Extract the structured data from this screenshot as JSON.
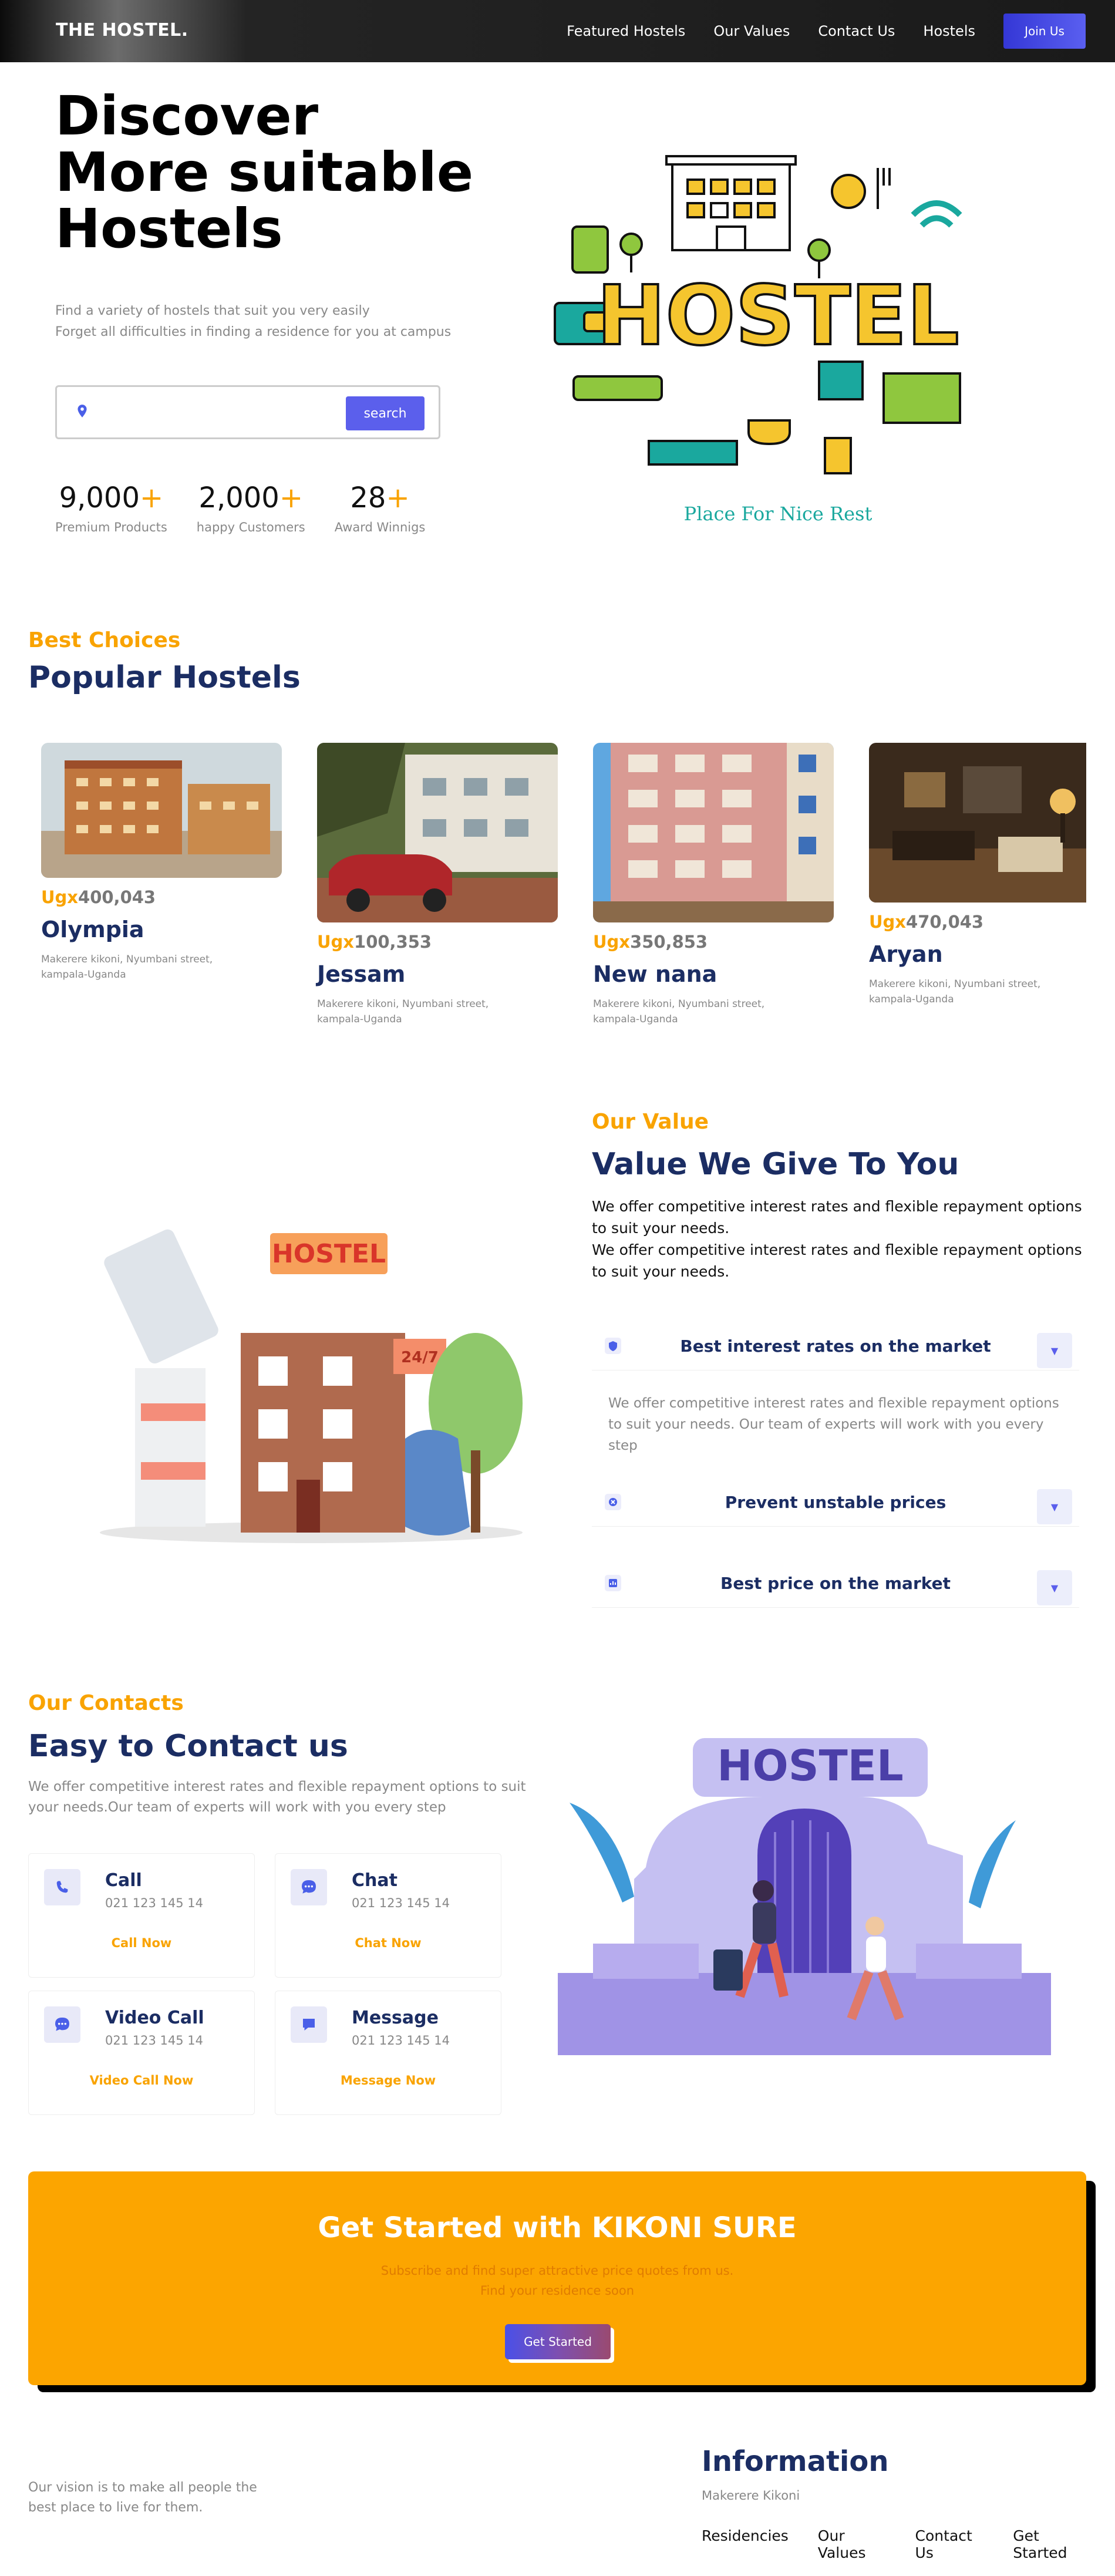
{
  "nav": {
    "logo": "THE HOSTEL.",
    "links": [
      "Featured Hostels",
      "Our Values",
      "Contact Us",
      "Hostels"
    ],
    "join": "Join Us"
  },
  "hero": {
    "title_lines": [
      "Discover",
      "More suitable",
      "Hostels"
    ],
    "subtitle_lines": [
      "Find a variety of hostels that suit you very easily",
      "Forget all difficulties in finding a residence for you at campus"
    ],
    "search": {
      "placeholder": "",
      "button": "search"
    },
    "stats": [
      {
        "num": "9,000",
        "plus": "+",
        "label": "Premium Products"
      },
      {
        "num": "2,000",
        "plus": "+",
        "label": "happy Customers"
      },
      {
        "num": "28",
        "plus": "+",
        "label": "Award Winnigs"
      }
    ],
    "art": {
      "word": "HOSTEL",
      "tagline": "Place For Nice Rest"
    }
  },
  "popular": {
    "eyebrow": "Best Choices",
    "title": "Popular Hostels",
    "items": [
      {
        "currency": "Ugx",
        "price": "400,043",
        "name": "Olympia",
        "address": "Makerere kikoni, Nyumbani street, kampala-Uganda"
      },
      {
        "currency": "Ugx",
        "price": "100,353",
        "name": "Jessam",
        "address": "Makerere kikoni, Nyumbani street, kampala-Uganda"
      },
      {
        "currency": "Ugx",
        "price": "350,853",
        "name": "New nana",
        "address": "Makerere kikoni, Nyumbani street, kampala-Uganda"
      },
      {
        "currency": "Ugx",
        "price": "470,043",
        "name": "Aryan",
        "address": "Makerere kikoni, Nyumbani street, kampala-Uganda"
      }
    ]
  },
  "values": {
    "eyebrow": "Our Value",
    "title": "Value We Give To You",
    "description": [
      "We offer competitive interest rates and flexible repayment options to suit your needs.",
      "We offer competitive interest rates and flexible repayment options to suit your needs."
    ],
    "art": {
      "sign": "HOSTEL",
      "badge": "24/7"
    },
    "items": [
      {
        "title": "Best interest rates on the market",
        "expanded": true,
        "body": "We offer competitive interest rates and flexible repayment options to suit your needs. Our team of experts will work with you every step"
      },
      {
        "title": "Prevent unstable prices",
        "expanded": false
      },
      {
        "title": "Best price on the market",
        "expanded": false
      }
    ]
  },
  "contacts": {
    "eyebrow": "Our Contacts",
    "title": "Easy to Contact us",
    "description": "We offer competitive interest rates and flexible repayment options to suit your needs.Our team of experts will work with you every step",
    "art": {
      "sign": "HOSTEL"
    },
    "cards": [
      {
        "title": "Call",
        "number": "021 123 145 14",
        "action": "Call Now",
        "icon": "phone-icon"
      },
      {
        "title": "Chat",
        "number": "021 123 145 14",
        "action": "Chat Now",
        "icon": "chat-bubble-icon"
      },
      {
        "title": "Video Call",
        "number": "021 123 145 14",
        "action": "Video Call Now",
        "icon": "chat-bubble-icon"
      },
      {
        "title": "Message",
        "number": "021 123 145 14",
        "action": "Message Now",
        "icon": "message-icon"
      }
    ]
  },
  "cta": {
    "title": "Get Started with KIKONI SURE",
    "sub_lines": [
      "Subscribe and find super attractive price quotes from us.",
      "Find your residence soon"
    ],
    "button": "Get Started"
  },
  "footer": {
    "vision": "Our vision is to make all people the best place to live for them.",
    "info_title": "Information",
    "address": "Makerere Kikoni",
    "links": [
      "Residencies",
      "Our Values",
      "Contact Us",
      "Get Started"
    ]
  },
  "colors": {
    "accent": "#f9a300",
    "brand": "#1b2d63",
    "button": "#5b5fec"
  }
}
